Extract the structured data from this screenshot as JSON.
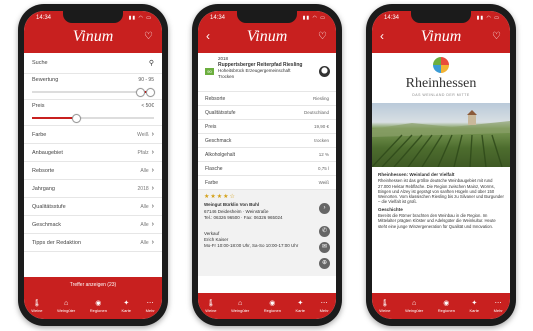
{
  "common": {
    "status_time": "14:34",
    "logo": "Vinum",
    "tabs": [
      {
        "icon": "🌡",
        "label": "Weine"
      },
      {
        "icon": "⌂",
        "label": "Weingüter"
      },
      {
        "icon": "◉",
        "label": "Regionen"
      },
      {
        "icon": "✦",
        "label": "Karte"
      },
      {
        "icon": "⋯",
        "label": "Mehr"
      }
    ]
  },
  "filter": {
    "search_label": "Suche",
    "rating_label": "Bewertung",
    "rating_value": "90 - 95",
    "rating_range": [
      0.88,
      0.96
    ],
    "price_label": "Preis",
    "price_value": "< 50€",
    "price_level": 0.36,
    "rows": [
      {
        "label": "Farbe",
        "value": "Weiß"
      },
      {
        "label": "Anbaugebiet",
        "value": "Pfalz"
      },
      {
        "label": "Rebsorte",
        "value": "Alle"
      },
      {
        "label": "Jahrgang",
        "value": "2018"
      },
      {
        "label": "Qualitätsstufe",
        "value": "Alle"
      },
      {
        "label": "Geschmack",
        "value": "Alle"
      },
      {
        "label": "Tipps der Redaktion",
        "value": "Alle"
      }
    ],
    "cta": "Treffer anzeigen (23)"
  },
  "wine": {
    "badge": "90",
    "year": "2018",
    "name": "Ruppertsberger Reiterpfad Riesling",
    "producer": "Hoheitsbrück Erzeugergemeinschaft",
    "type": "Trocken",
    "details": [
      {
        "label": "Rebsorte",
        "value": "Riesling"
      },
      {
        "label": "Qualitätsstufe",
        "value": "Deutschland"
      },
      {
        "label": "Preis",
        "value": "19,90 €"
      },
      {
        "label": "Geschmack",
        "value": "trocken"
      },
      {
        "label": "Alkoholgehalt",
        "value": "12 %"
      },
      {
        "label": "Flasche",
        "value": "0,75 l"
      },
      {
        "label": "Farbe",
        "value": "Weiß"
      }
    ],
    "stars": "★★★★☆",
    "winery_title": "Weingut Bürklin Von Buhl",
    "winery_address": "67146 Deidesheim · Weinstraße",
    "winery_phone": "Tel.: 06326 96500 · Fax: 06326 965024",
    "seller_label": "Verkauf",
    "seller_name": "Erich Kaiser",
    "seller_hours": "Mo-Fr 10:00-18:00 Uhr, Sa-So 10:00-17:00 Uhr"
  },
  "region": {
    "title": "Rheinhessen",
    "subtitle": "DAS WEINLAND DER MITTE",
    "intro_title": "Rheinhessen: Weinland der Vielfalt",
    "intro_text": "Rheinhessen ist das größte deutsche Weinbaugebiet mit rund 27.000 Hektar Rebfläche. Die Region zwischen Mainz, Worms, Bingen und Alzey ist geprägt von sanften Hügeln und über 150 Weinorten. Vom klassischen Riesling bis zu Silvaner und Burgunder – die Vielfalt ist groß.",
    "history_title": "Geschichte",
    "history_text": "Bereits die Römer brachten den Weinbau in die Region. Im Mittelalter prägten Klöster und Adelsgüter die Weinkultur. Heute steht eine junge Winzergeneration für Qualität und Innovation."
  }
}
